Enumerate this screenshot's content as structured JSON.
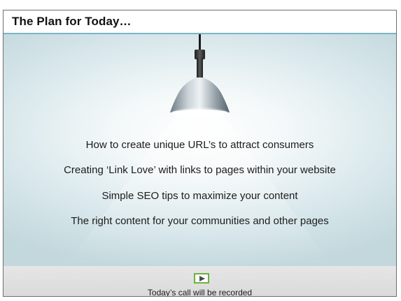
{
  "slide": {
    "title": "The Plan for Today…"
  },
  "agenda": [
    "How to create unique URL’s to attract consumers",
    "Creating ‘Link Love’ with links to pages within your website",
    "Simple SEO tips to maximize your content",
    "The right content for your communities and other pages"
  ],
  "footer": {
    "play_icon": "play-icon",
    "note": "Today’s call will be recorded"
  },
  "colors": {
    "title_rule": "#7ab6c7",
    "play_border": "#69b33b",
    "stage_light": "#ffffff",
    "stage_dark": "#c3d8dd"
  }
}
